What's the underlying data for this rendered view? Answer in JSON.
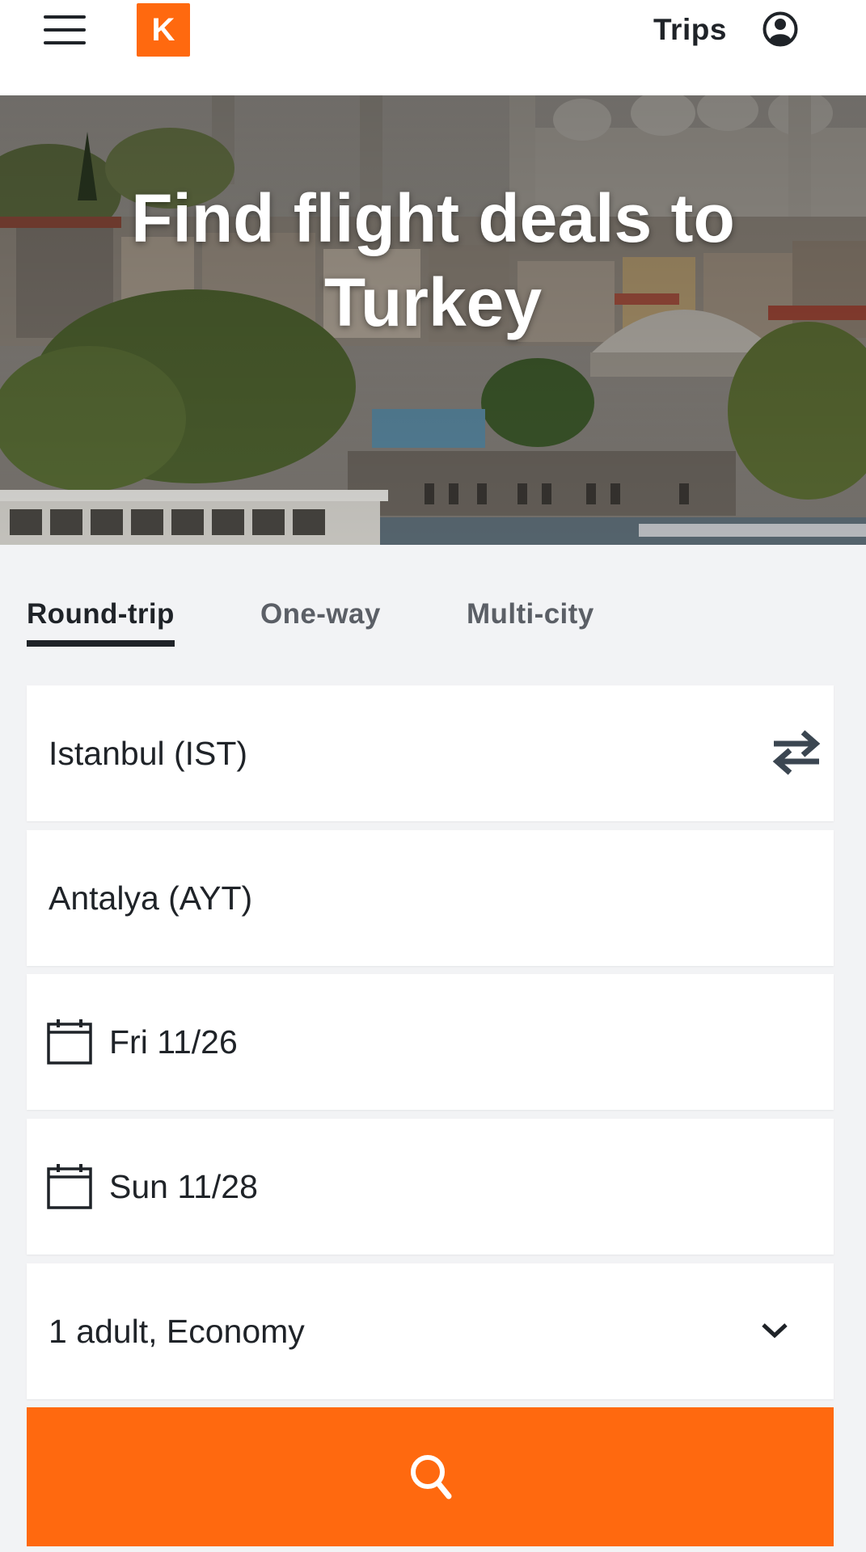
{
  "header": {
    "logo_letter": "K",
    "trips_label": "Trips"
  },
  "hero": {
    "title_line1": "Find flight deals to",
    "title_line2": "Turkey"
  },
  "tabs": [
    {
      "label": "Round-trip",
      "active": true
    },
    {
      "label": "One-way",
      "active": false
    },
    {
      "label": "Multi-city",
      "active": false
    }
  ],
  "form": {
    "origin": "Istanbul (IST)",
    "destination": "Antalya (AYT)",
    "depart_date": "Fri 11/26",
    "return_date": "Sun 11/28",
    "travelers_cabin": "1 adult, Economy"
  },
  "icons": {
    "menu": "hamburger-menu-icon",
    "account": "account-icon",
    "swap": "swap-arrows-icon",
    "calendar": "calendar-icon",
    "chevron": "chevron-down-icon",
    "search": "search-icon"
  },
  "colors": {
    "brand_orange": "#ff690f",
    "text_dark": "#1f2328",
    "page_bg": "#f2f3f5"
  }
}
